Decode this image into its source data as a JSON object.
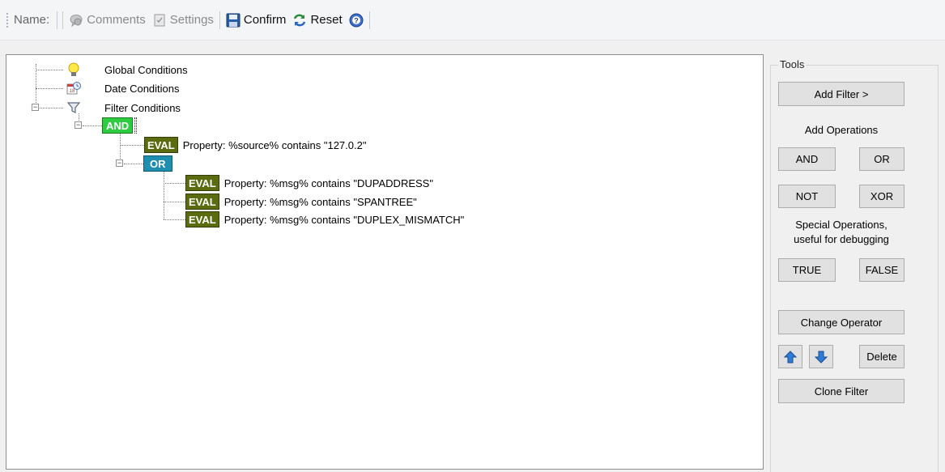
{
  "toolbar": {
    "name_label": "Name:",
    "comments_label": "Comments",
    "settings_label": "Settings",
    "confirm_label": "Confirm",
    "reset_label": "Reset"
  },
  "tree": {
    "global_conditions": "Global Conditions",
    "date_conditions": "Date Conditions",
    "filter_conditions": "Filter Conditions",
    "and_badge": "AND",
    "or_badge": "OR",
    "eval_badge": "EVAL",
    "eval_items": [
      "Property: %source% contains \"127.0.2\"",
      "Property: %msg% contains \"DUPADDRESS\"",
      "Property: %msg% contains \"SPANTREE\"",
      "Property: %msg% contains \"DUPLEX_MISMATCH\""
    ]
  },
  "tools": {
    "legend": "Tools",
    "add_filter": "Add Filter >",
    "add_operations_label": "Add Operations",
    "and": "AND",
    "or": "OR",
    "not": "NOT",
    "xor": "XOR",
    "special_label_1": "Special Operations,",
    "special_label_2": "useful for debugging",
    "true": "TRUE",
    "false": "FALSE",
    "change_operator": "Change Operator",
    "delete": "Delete",
    "clone_filter": "Clone Filter"
  },
  "colors": {
    "and_badge": "#2ecc40",
    "or_badge": "#1f8fb0",
    "eval_badge": "#5a6b10"
  }
}
